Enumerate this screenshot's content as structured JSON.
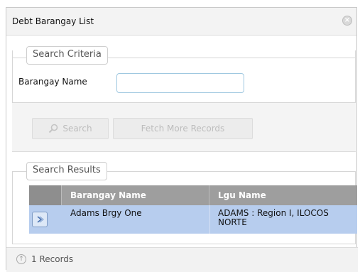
{
  "window": {
    "title": "Debt Barangay List",
    "close_icon": "close-icon"
  },
  "criteria": {
    "legend": "Search Criteria",
    "barangay_label": "Barangay Name",
    "barangay_value": ""
  },
  "toolbar": {
    "search_label": "Search",
    "search_icon": "search-icon",
    "fetch_label": "Fetch More Records"
  },
  "results": {
    "legend": "Search Results",
    "columns": [
      "Barangay Name",
      "Lgu Name"
    ],
    "rows": [
      {
        "barangay_name": "Adams Brgy One",
        "lgu_name": "ADAMS : Region I, ILOCOS NORTE",
        "select_icon": "chevron-right-icon"
      }
    ]
  },
  "footer": {
    "info_icon": "info-icon",
    "records_text": "1 Records"
  },
  "colors": {
    "selected_row": "#b7cdee",
    "header_bg": "#9e9e9e"
  }
}
